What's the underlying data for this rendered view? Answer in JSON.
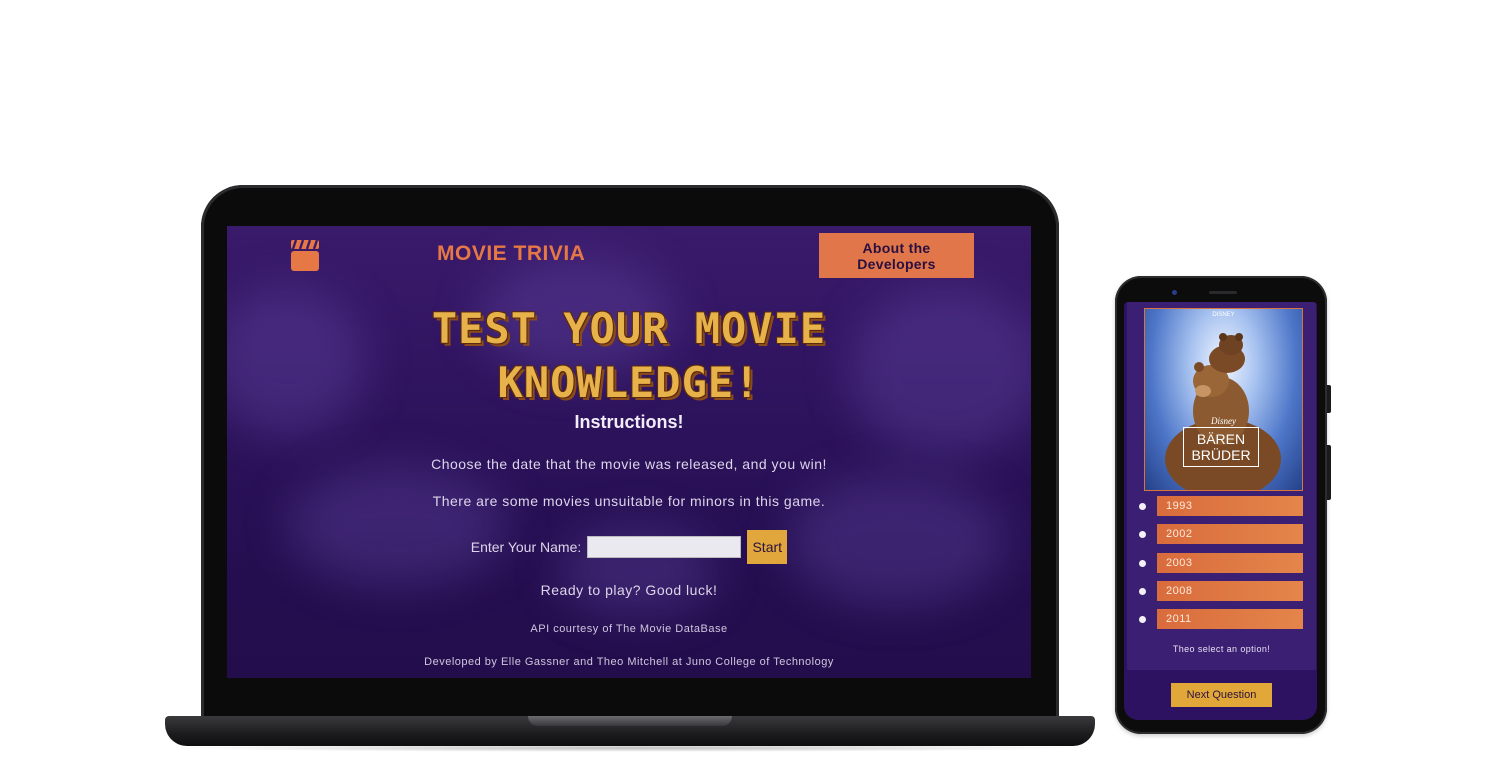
{
  "laptop": {
    "header": {
      "title": "MOVIE TRIVIA",
      "about_button": "About the Developers"
    },
    "hero": {
      "line1": "TEST YOUR MOVIE",
      "line2": "KNOWLEDGE!"
    },
    "instructions": {
      "title": "Instructions!",
      "line1": "Choose the date that the movie was released, and you win!",
      "line2": "There are some movies unsuitable for minors in this game."
    },
    "form": {
      "name_label": "Enter Your Name:",
      "name_value": "",
      "start_button": "Start"
    },
    "ready_text": "Ready to play? Good luck!",
    "footer": {
      "api_credit": "API courtesy of The Movie DataBase",
      "developers": "Developed by Elle Gassner and Theo Mitchell at Juno College of Technology"
    },
    "colors": {
      "accent_orange": "#e0764a",
      "accent_gold": "#e8b24a",
      "background_purple": "#2f145f"
    }
  },
  "phone": {
    "poster": {
      "small_brand": "DISNEY",
      "brand": "Disney",
      "title_line1": "BÄREN",
      "title_line2": "BRÜDER"
    },
    "options": [
      "1993",
      "2002",
      "2003",
      "2008",
      "2011"
    ],
    "status": "Theo select an option!",
    "next_button": "Next Question"
  }
}
